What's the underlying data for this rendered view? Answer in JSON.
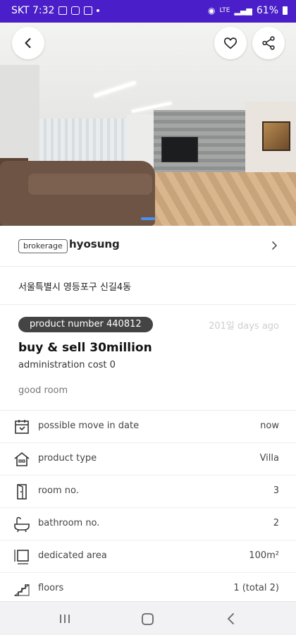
{
  "status_bar": {
    "carrier_time": "SKT 7:32",
    "lte_label": "LTE",
    "battery": "61%"
  },
  "hero": {
    "back_icon": "back-arrow-icon",
    "favorite_icon": "heart-icon",
    "share_icon": "share-icon"
  },
  "broker": {
    "tag": "brokerage",
    "name": "hyosung"
  },
  "address": "서울특별시 영등포구 신길4동",
  "listing": {
    "product_number": "product number 440812",
    "posted_ago": "201일 days ago",
    "price": "buy & sell 30million",
    "administration_cost": "administration cost 0",
    "description": "good room"
  },
  "attributes": [
    {
      "icon": "calendar-icon",
      "label": "possible move in date",
      "value": "now"
    },
    {
      "icon": "house-icon",
      "label": "product type",
      "value": "Villa"
    },
    {
      "icon": "door-icon",
      "label": "room no.",
      "value": "3"
    },
    {
      "icon": "bathtub-icon",
      "label": "bathroom no.",
      "value": "2"
    },
    {
      "icon": "area-icon",
      "label": "dedicated area",
      "value": "100m²"
    },
    {
      "icon": "stairs-icon",
      "label": "floors",
      "value": "1 (total 2)"
    }
  ],
  "colors": {
    "status_bar": "#4a1ec8",
    "badge": "#444444",
    "indicator": "#4b8ff0"
  }
}
